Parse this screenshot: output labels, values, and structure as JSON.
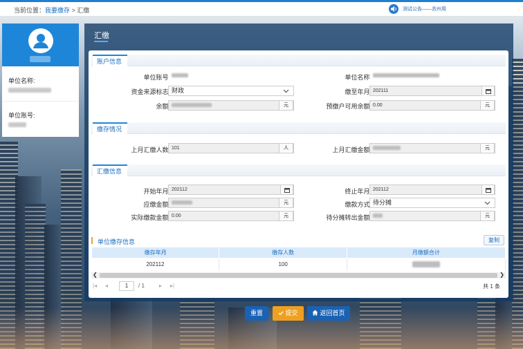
{
  "breadcrumb": {
    "prefix": "当前位置：",
    "link": "我要缴存",
    "separator": " > ",
    "current": "汇缴"
  },
  "notice": {
    "text": "测试公告——苏州用"
  },
  "user_card": {
    "unit_name_label": "单位名称:",
    "unit_name_value": "",
    "unit_account_label": "单位账号:",
    "unit_account_value": ""
  },
  "panel": {
    "title": "汇缴"
  },
  "sections": {
    "account": {
      "title": "账户信息",
      "unit_account_label": "单位账号:",
      "unit_account_value": "",
      "unit_name_label": "单位名称:",
      "unit_name_value": "",
      "fund_source_label": "资金来源标志:",
      "fund_source_value": "财政",
      "paid_until_label": "缴至年月:",
      "paid_until_value": "202111",
      "balance_label": "余额:",
      "balance_value": "",
      "balance_unit": "元",
      "prepaid_label": "预缴户可用余额:",
      "prepaid_value": "0.00",
      "prepaid_unit": "元"
    },
    "deposit": {
      "title": "缴存情况",
      "last_count_label": "上月汇缴人数:",
      "last_count_value": "101",
      "last_count_unit": "人",
      "last_amount_label": "上月汇缴金额:",
      "last_amount_value": "",
      "last_amount_unit": "元"
    },
    "remit": {
      "title": "汇缴信息",
      "start_label": "开始年月:",
      "start_value": "202112",
      "end_label": "终止年月:",
      "end_value": "202112",
      "due_label": "应缴金额:",
      "due_value": "",
      "due_unit": "元",
      "method_label": "缴款方式:",
      "method_value": "待分摊",
      "actual_label": "实际缴款金额:",
      "actual_value": "0.00",
      "actual_unit": "元",
      "transfer_label": "待分摊转出金额:",
      "transfer_value": "",
      "transfer_unit": "元"
    }
  },
  "grid": {
    "title": "单位缴存信息",
    "copy_label": "复制",
    "columns": [
      "缴存年月",
      "缴存人数",
      "月缴额合计"
    ],
    "rows": [
      {
        "month": "202112",
        "count": "100",
        "total": ""
      }
    ],
    "pager": {
      "page": "1",
      "of": "/ 1",
      "total": "共 1 条"
    }
  },
  "buttons": {
    "reset": "重置",
    "submit": "提交",
    "back": "返回首页"
  },
  "colors": {
    "primary": "#1e86d8",
    "accent": "#f0a020",
    "panel": "#123a64"
  }
}
